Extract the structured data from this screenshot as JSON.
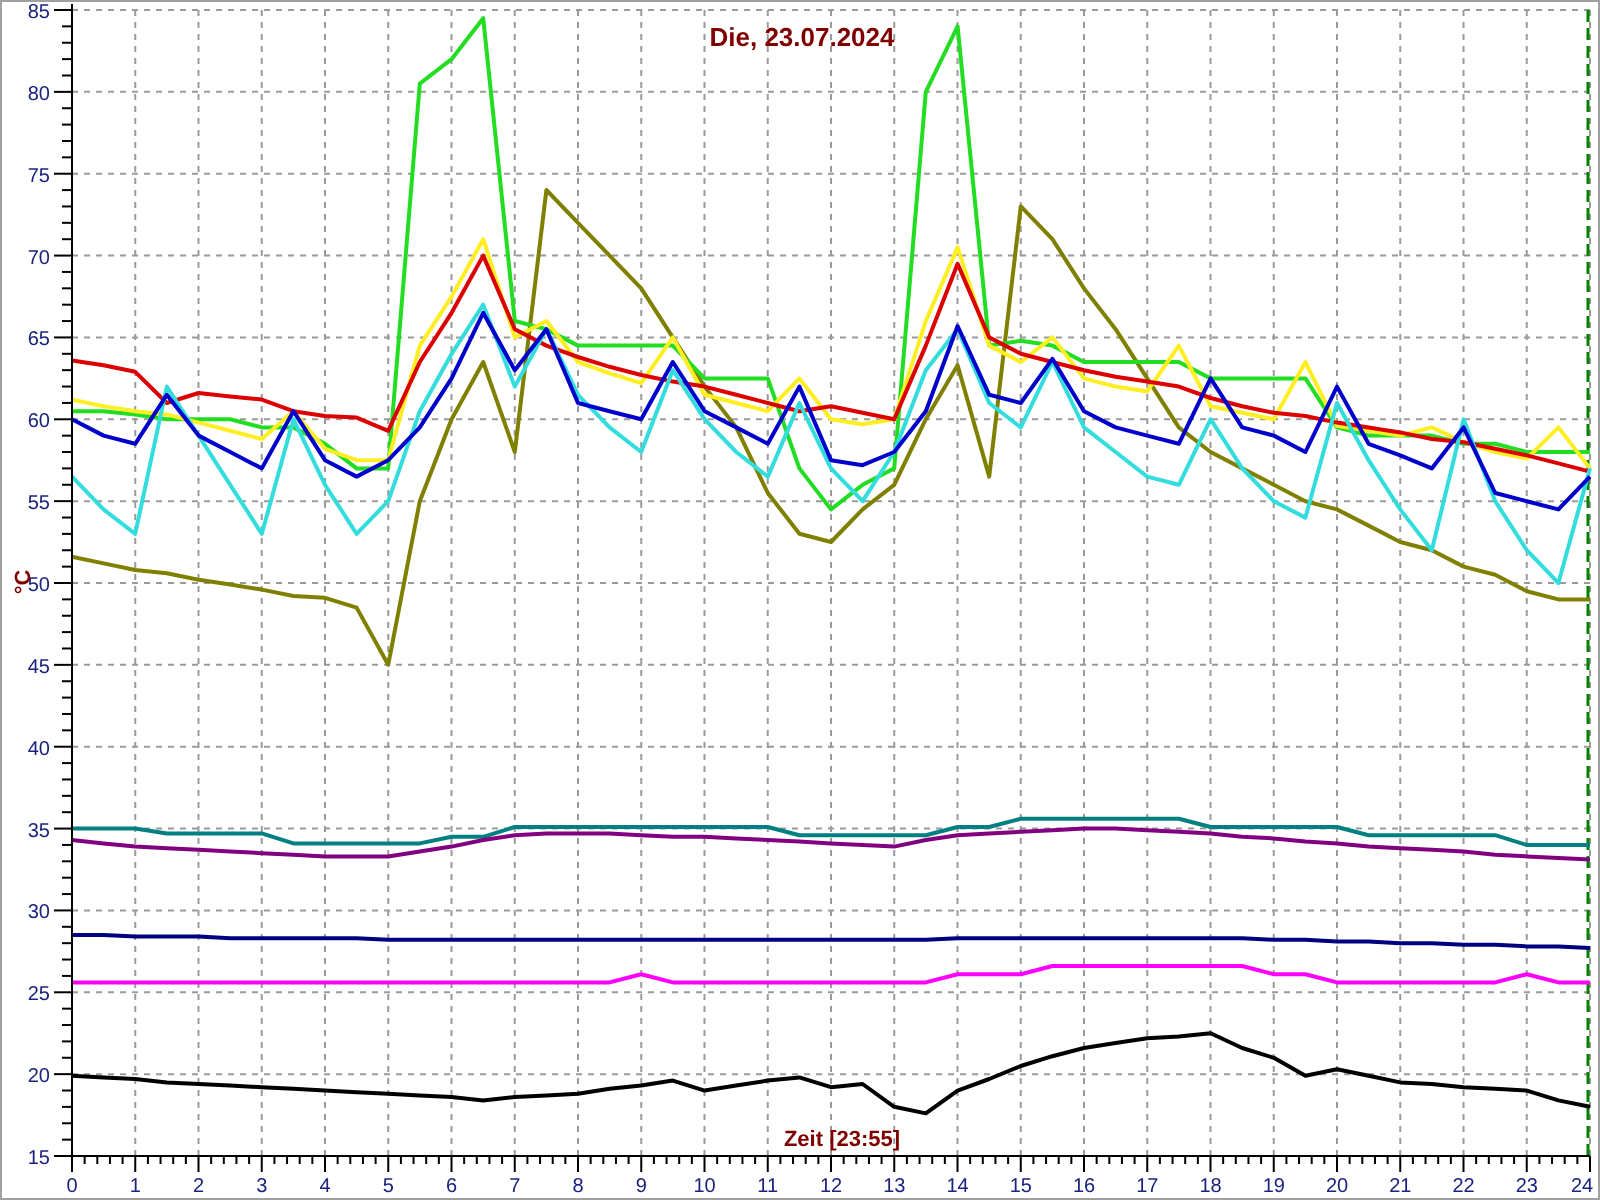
{
  "chart_data": {
    "type": "line",
    "title": "Die, 23.07.2024",
    "xlabel": "Zeit [23:55]",
    "ylabel": "°C",
    "x": [
      0,
      0.5,
      1,
      1.5,
      2,
      2.5,
      3,
      3.5,
      4,
      4.5,
      5,
      5.5,
      6,
      6.5,
      7,
      7.5,
      8,
      8.5,
      9,
      9.5,
      10,
      10.5,
      11,
      11.5,
      12,
      12.5,
      13,
      13.5,
      14,
      14.5,
      15,
      15.5,
      16,
      16.5,
      17,
      17.5,
      18,
      18.5,
      19,
      19.5,
      20,
      20.5,
      21,
      21.5,
      22,
      22.5,
      23,
      23.5,
      24
    ],
    "xlim": [
      0,
      24
    ],
    "ylim": [
      15,
      85
    ],
    "xticks": [
      0,
      1,
      2,
      3,
      4,
      5,
      6,
      7,
      8,
      9,
      10,
      11,
      12,
      13,
      14,
      15,
      16,
      17,
      18,
      19,
      20,
      21,
      22,
      23,
      24
    ],
    "yticks": [
      15,
      20,
      25,
      30,
      35,
      40,
      45,
      50,
      55,
      60,
      65,
      70,
      75,
      80,
      85
    ],
    "series": [
      {
        "color": "#008080",
        "values": [
          35,
          35,
          35,
          34.7,
          34.7,
          34.7,
          34.7,
          34.1,
          34.1,
          34.1,
          34.1,
          34.1,
          34.5,
          34.5,
          35.1,
          35.1,
          35.1,
          35.1,
          35.1,
          35.1,
          35.1,
          35.1,
          35.1,
          34.6,
          34.6,
          34.6,
          34.6,
          34.6,
          35.1,
          35.1,
          35.6,
          35.6,
          35.6,
          35.6,
          35.6,
          35.6,
          35.1,
          35.1,
          35.1,
          35.1,
          35.1,
          34.6,
          34.6,
          34.6,
          34.6,
          34.6,
          34,
          34,
          34
        ]
      },
      {
        "color": "#800080",
        "values": [
          34.3,
          34.1,
          33.9,
          33.8,
          33.7,
          33.6,
          33.5,
          33.4,
          33.3,
          33.3,
          33.3,
          33.6,
          33.9,
          34.3,
          34.6,
          34.7,
          34.7,
          34.7,
          34.6,
          34.5,
          34.5,
          34.4,
          34.3,
          34.2,
          34.1,
          34,
          33.9,
          34.3,
          34.6,
          34.7,
          34.8,
          34.9,
          35,
          35,
          34.9,
          34.8,
          34.7,
          34.5,
          34.4,
          34.2,
          34.1,
          33.9,
          33.8,
          33.7,
          33.6,
          33.4,
          33.3,
          33.2,
          33.1
        ]
      },
      {
        "color": "#000080",
        "values": [
          28.5,
          28.5,
          28.4,
          28.4,
          28.4,
          28.3,
          28.3,
          28.3,
          28.3,
          28.3,
          28.2,
          28.2,
          28.2,
          28.2,
          28.2,
          28.2,
          28.2,
          28.2,
          28.2,
          28.2,
          28.2,
          28.2,
          28.2,
          28.2,
          28.2,
          28.2,
          28.2,
          28.2,
          28.3,
          28.3,
          28.3,
          28.3,
          28.3,
          28.3,
          28.3,
          28.3,
          28.3,
          28.3,
          28.2,
          28.2,
          28.1,
          28.1,
          28,
          28,
          27.9,
          27.9,
          27.8,
          27.8,
          27.7
        ]
      },
      {
        "color": "#ff00ff",
        "values": [
          25.6,
          25.6,
          25.6,
          25.6,
          25.6,
          25.6,
          25.6,
          25.6,
          25.6,
          25.6,
          25.6,
          25.6,
          25.6,
          25.6,
          25.6,
          25.6,
          25.6,
          25.6,
          26.1,
          25.6,
          25.6,
          25.6,
          25.6,
          25.6,
          25.6,
          25.6,
          25.6,
          25.6,
          26.1,
          26.1,
          26.1,
          26.6,
          26.6,
          26.6,
          26.6,
          26.6,
          26.6,
          26.6,
          26.1,
          26.1,
          25.6,
          25.6,
          25.6,
          25.6,
          25.6,
          25.6,
          26.1,
          25.6,
          25.6
        ]
      },
      {
        "color": "#000000",
        "values": [
          19.9,
          19.8,
          19.7,
          19.5,
          19.4,
          19.3,
          19.2,
          19.1,
          19,
          18.9,
          18.8,
          18.7,
          18.6,
          18.4,
          18.6,
          18.7,
          18.8,
          19.1,
          19.3,
          19.6,
          19,
          19.3,
          19.6,
          19.8,
          19.2,
          19.4,
          18,
          17.6,
          19,
          19.7,
          20.5,
          21.1,
          21.6,
          21.9,
          22.2,
          22.3,
          22.5,
          21.6,
          21,
          19.9,
          20.3,
          19.9,
          19.5,
          19.4,
          19.2,
          19.1,
          19,
          18.4,
          18
        ]
      },
      {
        "color": "#808000",
        "values": [
          51.6,
          51.2,
          50.8,
          50.6,
          50.2,
          49.9,
          49.6,
          49.2,
          49.1,
          48.5,
          45,
          55,
          60,
          63.5,
          58,
          74,
          72,
          70,
          68,
          65,
          62,
          59.5,
          55.5,
          53,
          52.5,
          54.5,
          56,
          60,
          63.3,
          56.5,
          73,
          71,
          68,
          65.5,
          62.5,
          59.5,
          58,
          57,
          56,
          55,
          54.5,
          53.5,
          52.5,
          52,
          51,
          50.5,
          49.5,
          49,
          49
        ]
      },
      {
        "color": "#22dd22",
        "values": [
          60.5,
          60.5,
          60.3,
          60,
          60,
          60,
          59.5,
          59.5,
          58.5,
          57,
          57,
          80.5,
          82,
          84.5,
          66,
          65.5,
          64.5,
          64.5,
          64.5,
          64.5,
          62.5,
          62.5,
          62.5,
          57,
          54.5,
          56,
          57,
          80,
          84,
          64.5,
          64.8,
          64.5,
          63.5,
          63.5,
          63.5,
          63.5,
          62.5,
          62.5,
          62.5,
          62.5,
          59.5,
          59,
          59,
          59,
          58.5,
          58.5,
          58,
          58,
          58
        ]
      },
      {
        "color": "#ffee22",
        "values": [
          61.2,
          60.8,
          60.5,
          60.3,
          59.8,
          59.3,
          58.8,
          60.5,
          58.2,
          57.5,
          57.5,
          64.5,
          67.5,
          71,
          65,
          66,
          63.5,
          62.8,
          62.2,
          65,
          61.5,
          61,
          60.5,
          62.5,
          60,
          59.7,
          60,
          66,
          70.5,
          64.5,
          63.5,
          65,
          62.5,
          62,
          61.7,
          64.5,
          60.8,
          60.4,
          60,
          63.5,
          59.6,
          59.3,
          59,
          59.5,
          58.6,
          58,
          57.6,
          59.5,
          57
        ]
      },
      {
        "color": "#dd0000",
        "values": [
          63.6,
          63.3,
          62.9,
          61,
          61.6,
          61.4,
          61.2,
          60.5,
          60.2,
          60.1,
          59.3,
          63.5,
          66.5,
          70,
          65.5,
          64.5,
          63.8,
          63.2,
          62.7,
          62.3,
          62,
          61.5,
          61,
          60.5,
          60.8,
          60.4,
          60,
          64.5,
          69.5,
          65,
          64,
          63.5,
          63,
          62.6,
          62.3,
          62,
          61.3,
          60.8,
          60.4,
          60.2,
          59.8,
          59.5,
          59.2,
          58.8,
          58.6,
          58.2,
          57.8,
          57.3,
          56.8
        ]
      },
      {
        "color": "#33dddd",
        "values": [
          56.5,
          54.5,
          53,
          62,
          59,
          56,
          53,
          60,
          56,
          53,
          55,
          60.5,
          64,
          67,
          62,
          65.5,
          61.5,
          59.5,
          58,
          63,
          60,
          58,
          56.5,
          61,
          57,
          55,
          58,
          63,
          65.5,
          61,
          59.5,
          63.5,
          59.5,
          58,
          56.5,
          56,
          60,
          57,
          55,
          54,
          61,
          57.5,
          54.5,
          52,
          60,
          55,
          52,
          50,
          57
        ]
      },
      {
        "color": "#0000cc",
        "values": [
          60,
          59,
          58.5,
          61.5,
          59,
          58,
          57,
          60.5,
          57.5,
          56.5,
          57.5,
          59.5,
          62.5,
          66.5,
          63,
          65.5,
          61,
          60.5,
          60,
          63.5,
          60.5,
          59.5,
          58.5,
          62,
          57.5,
          57.2,
          58,
          60.5,
          65.7,
          61.5,
          61,
          63.7,
          60.5,
          59.5,
          59,
          58.5,
          62.5,
          59.5,
          59,
          58,
          62,
          58.5,
          57.8,
          57,
          59.5,
          55.5,
          55,
          54.5,
          56.5
        ]
      }
    ],
    "grid": true
  }
}
